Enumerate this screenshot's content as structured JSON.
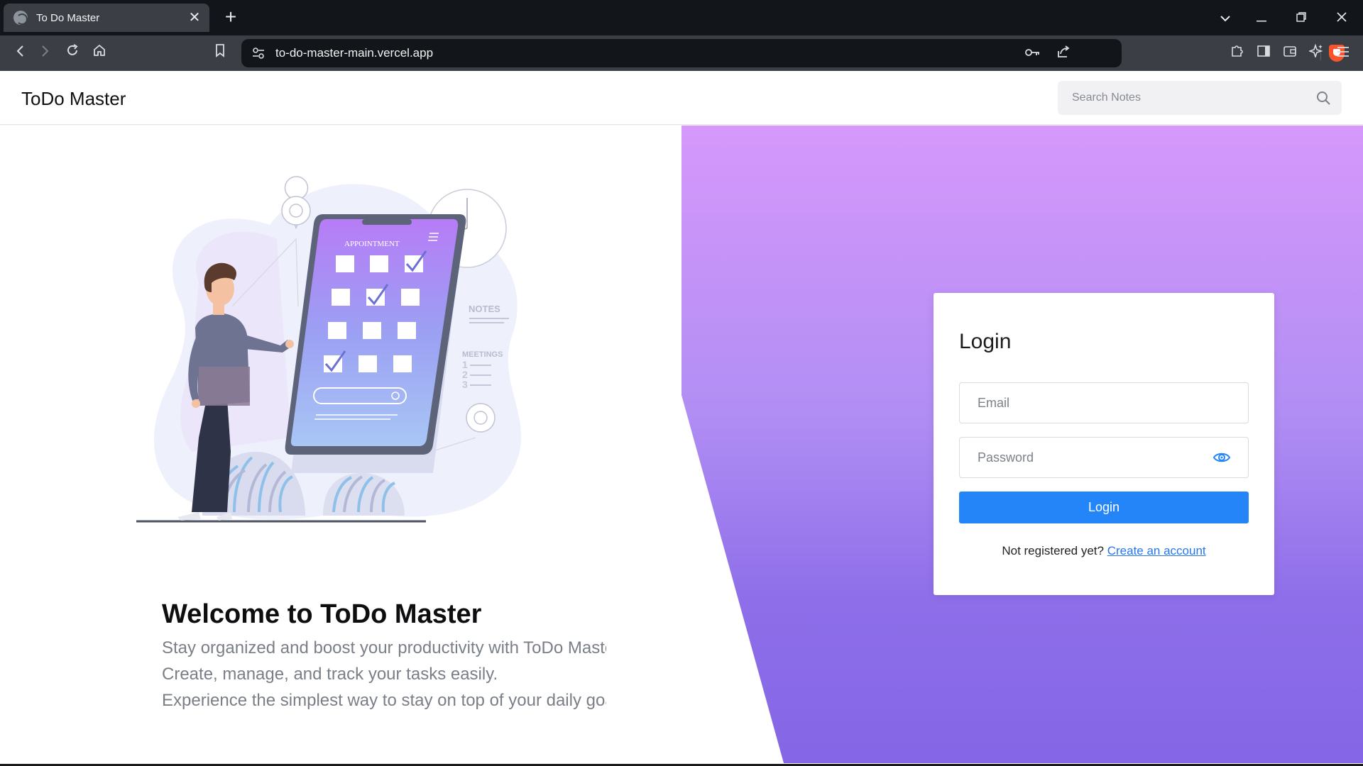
{
  "browser": {
    "tab_title": "To Do Master",
    "tab_close": "✕",
    "new_tab": "+",
    "url": "to-do-master-main.vercel.app",
    "window_controls": {
      "dropdown": "⌄",
      "minimize": "—",
      "restore": "❐",
      "close": "✕"
    },
    "nav": {
      "back": "‹",
      "forward": "›",
      "reload": "↻",
      "home": "⌂",
      "bookmark": "☐"
    },
    "icons": [
      "key-icon",
      "share-icon",
      "brave-shield-icon",
      "extensions-icon",
      "sidebar-icon",
      "wallet-icon",
      "leo-ai-icon",
      "menu-icon"
    ]
  },
  "header": {
    "brand": "ToDo Master",
    "search_placeholder": "Search Notes"
  },
  "hero": {
    "title": "Welcome to ToDo Master",
    "lines": [
      "Stay organized and boost your productivity with ToDo Master.",
      "Create, manage, and track your tasks easily.",
      "Experience the simplest way to stay on top of your daily goals."
    ],
    "illustration_text": {
      "appointment": "APPOINTMENT",
      "notes": "NOTES",
      "meetings": "MEETINGS",
      "list_numbers": [
        "1",
        "2",
        "3"
      ]
    }
  },
  "login": {
    "heading": "Login",
    "email_placeholder": "Email",
    "password_placeholder": "Password",
    "button_label": "Login",
    "register_prompt": "Not registered yet?",
    "register_link": "Create an account"
  },
  "colors": {
    "accent": "#2385f7",
    "link": "#2676f0",
    "gradient_top": "#d698fb",
    "gradient_bottom": "#8466e6",
    "browser_dark": "#121519",
    "browser_toolbar": "#3b3f45"
  }
}
